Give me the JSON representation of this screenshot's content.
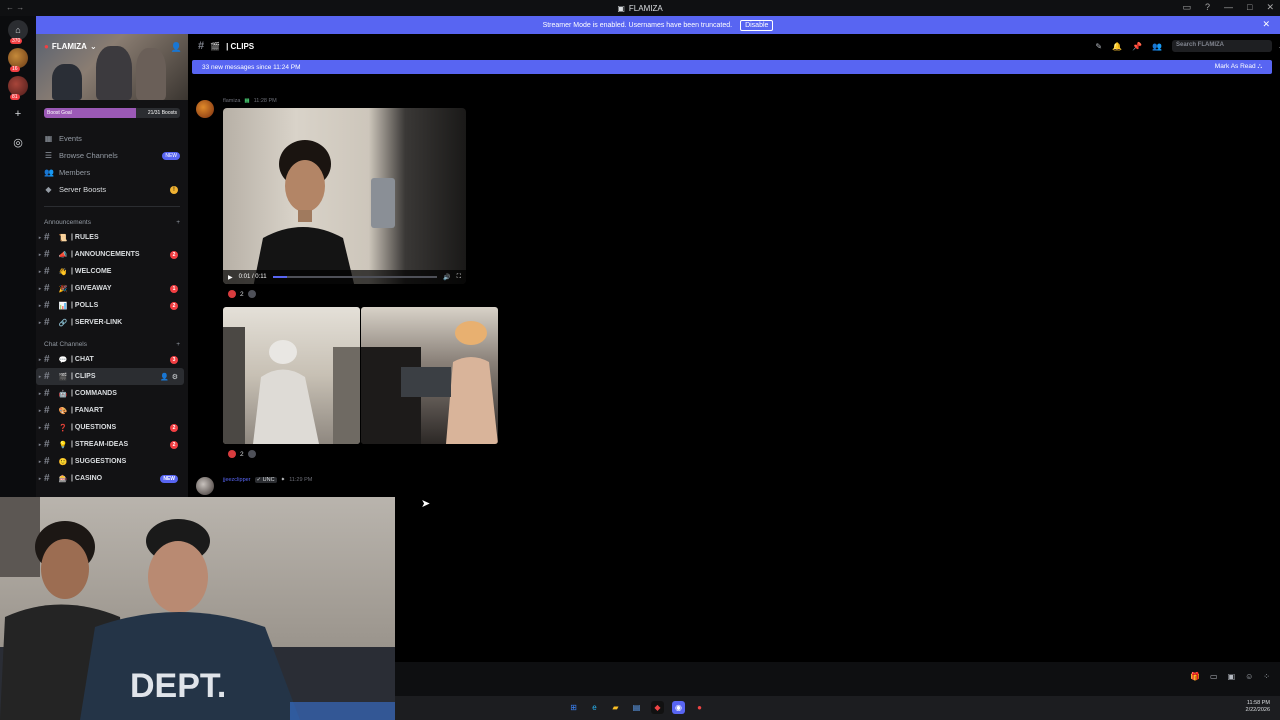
{
  "window": {
    "title": "FLAMIZA"
  },
  "banner": {
    "text": "Streamer Mode is enabled. Usernames have been truncated.",
    "action": "Disable"
  },
  "rail": {
    "badges": [
      "370",
      "16",
      "81"
    ]
  },
  "server": {
    "name": "FLAMIZA",
    "boost_goal": {
      "label": "Boost Goal",
      "count": "21/31 Boosts",
      "progress": 0.68
    },
    "nav": [
      {
        "label": "Events",
        "icon": "calendar-icon"
      },
      {
        "label": "Browse Channels",
        "icon": "browse-icon",
        "badge": "NEW"
      },
      {
        "label": "Members",
        "icon": "members-icon"
      },
      {
        "label": "Server Boosts",
        "icon": "boost-icon",
        "badge": "!"
      }
    ],
    "categories": [
      {
        "label": "Announcements",
        "channels": [
          {
            "name": "| RULES",
            "emoji": "📜"
          },
          {
            "name": "| ANNOUNCEMENTS",
            "emoji": "📣",
            "count": "2"
          },
          {
            "name": "| WELCOME",
            "emoji": "👋"
          },
          {
            "name": "| GIVEAWAY",
            "emoji": "🎉",
            "count": "1"
          },
          {
            "name": "| POLLS",
            "emoji": "📊",
            "count": "2"
          },
          {
            "name": "| SERVER-LINK",
            "emoji": "🔗"
          }
        ]
      },
      {
        "label": "Chat Channels",
        "channels": [
          {
            "name": "| CHAT",
            "emoji": "💬",
            "count": "3"
          },
          {
            "name": "| CLIPS",
            "emoji": "🎬",
            "active": true
          },
          {
            "name": "| COMMANDS",
            "emoji": "🤖"
          },
          {
            "name": "| FANART",
            "emoji": "🎨"
          },
          {
            "name": "| QUESTIONS",
            "emoji": "❓",
            "count": "2"
          },
          {
            "name": "| STREAM-IDEAS",
            "emoji": "💡",
            "count": "2"
          },
          {
            "name": "| SUGGESTIONS",
            "emoji": "🙂"
          },
          {
            "name": "| CASINO",
            "emoji": "🎰",
            "badge": "NEW"
          }
        ]
      }
    ]
  },
  "channel": {
    "name": "| CLIPS",
    "search_placeholder": "Search FLAMIZA"
  },
  "new_messages": {
    "text": "33 new messages since 11:24 PM",
    "action": "Mark As Read"
  },
  "messages": [
    {
      "author": "flamiza",
      "time": "11:28 PM",
      "video_time": "0:01 / 0:11",
      "video_progress": 0.09,
      "reaction_count": "2"
    },
    {
      "reaction_count": "2"
    },
    {
      "author": "jjeezclipper",
      "tag": "UNC",
      "time": "11:29 PM"
    }
  ],
  "taskbar": {
    "time": "11:58 PM",
    "date": "2/22/2026"
  },
  "colors": {
    "accent": "#5865f2",
    "danger": "#f23f43",
    "sidebar": "#121214"
  }
}
